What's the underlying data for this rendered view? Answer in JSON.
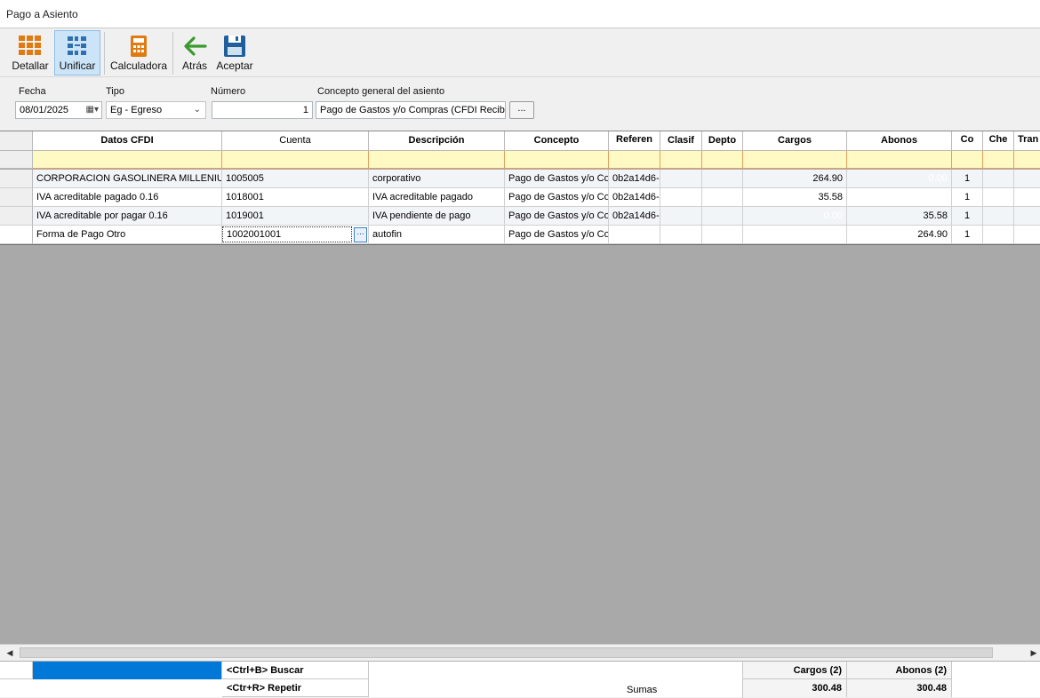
{
  "window": {
    "title": "Pago a Asiento"
  },
  "toolbar": {
    "detallar": "Detallar",
    "unificar": "Unificar",
    "calculadora": "Calculadora",
    "atras": "Atrás",
    "aceptar": "Aceptar"
  },
  "form": {
    "fecha_label": "Fecha",
    "fecha_value": "08/01/2025",
    "tipo_label": "Tipo",
    "tipo_value": "Eg - Egreso",
    "numero_label": "Número",
    "numero_value": "1",
    "concepto_label": "Concepto general del asiento",
    "concepto_value": "Pago de Gastos y/o Compras (CFDI Recibi",
    "ellipsis": "..."
  },
  "grid": {
    "columns": [
      "Datos CFDI",
      "Cuenta",
      "Descripción",
      "Concepto",
      "Referen",
      "Clasif",
      "Depto",
      "Cargos",
      "Abonos",
      "Co",
      "Che",
      "Tran"
    ],
    "rows": [
      {
        "datos": "CORPORACION GASOLINERA MILLENIUM (",
        "cuenta": "1005005",
        "descripcion": "corporativo",
        "concepto": "Pago de Gastos y/o Co",
        "referen": "0b2a14d6-",
        "cargos": "264.90",
        "abonos": "0.00",
        "co": "1"
      },
      {
        "datos": "IVA acreditable pagado 0.16",
        "cuenta": "1018001",
        "descripcion": "IVA acreditable pagado",
        "concepto": "Pago de Gastos y/o Co",
        "referen": "0b2a14d6-",
        "cargos": "35.58",
        "abonos": "",
        "co": "1"
      },
      {
        "datos": "IVA acreditable por pagar 0.16",
        "cuenta": "1019001",
        "descripcion": "IVA pendiente de pago",
        "concepto": "Pago de Gastos y/o Co",
        "referen": "0b2a14d6-",
        "cargos": "0.00",
        "abonos": "35.58",
        "co": "1"
      },
      {
        "datos": "Forma de Pago Otro",
        "cuenta": "1002001001",
        "descripcion": "autofin",
        "concepto": "Pago de Gastos y/o Co",
        "referen": "",
        "cargos": "",
        "abonos": "264.90",
        "co": "1"
      }
    ]
  },
  "footer": {
    "buscar": "<Ctrl+B> Buscar",
    "repetir": "<Ctr+R> Repetir",
    "sumas": "Sumas",
    "cargos_label": "Cargos (2)",
    "abonos_label": "Abonos (2)",
    "cargos_total": "300.48",
    "abonos_total": "300.48"
  }
}
